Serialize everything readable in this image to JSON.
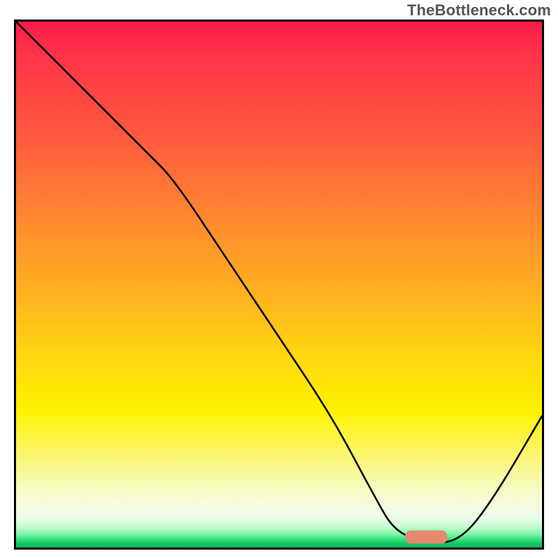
{
  "watermark": "TheBottleneck.com",
  "chart_data": {
    "type": "line",
    "title": "",
    "xlabel": "",
    "ylabel": "",
    "xlim": [
      0,
      100
    ],
    "ylim": [
      0,
      100
    ],
    "grid": false,
    "legend": false,
    "annotations": [],
    "series": [
      {
        "name": "bottleneck-curve",
        "x": [
          0,
          10,
          20,
          25,
          30,
          40,
          50,
          60,
          68,
          72,
          78,
          84,
          90,
          100
        ],
        "y": [
          100,
          90,
          80,
          75,
          70,
          55,
          40,
          25,
          10,
          3,
          1,
          1,
          8,
          25
        ]
      }
    ],
    "marker": {
      "name": "optimal-range",
      "x_start": 74,
      "x_end": 82,
      "y": 2,
      "thickness": 2.5
    },
    "background_gradient": {
      "top": "#ff1a4b",
      "mid": "#ffd80f",
      "bottom": "#0fb256"
    }
  }
}
